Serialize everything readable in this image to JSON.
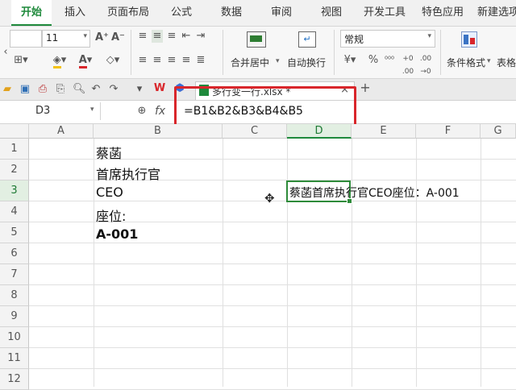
{
  "ribbon_tabs": [
    "开始",
    "插入",
    "页面布局",
    "公式",
    "数据",
    "审阅",
    "视图",
    "开发工具",
    "特色应用",
    "新建选项"
  ],
  "font_size": "11",
  "merge_label": "合并居中",
  "wrap_label": "自动换行",
  "number_format": "常规",
  "cond_format_label": "条件格式",
  "table_label": "表格",
  "document_tab": "多行变一行.xlsx *",
  "name_box": "D3",
  "fx_label": "fx",
  "formula": "=B1&B2&B3&B4&B5",
  "columns": [
    "A",
    "B",
    "C",
    "D",
    "E",
    "F",
    "G"
  ],
  "rows": [
    "1",
    "2",
    "3",
    "4",
    "5",
    "6",
    "7",
    "8",
    "9",
    "10",
    "11",
    "12"
  ],
  "cells": {
    "B1": "蔡菡",
    "B2": "首席执行官",
    "B3": "CEO",
    "B4": "座位:",
    "B5": "A-001",
    "D3": "蔡菡首席执行官CEO座位：A-001"
  },
  "accent_color": "#1f8a3c",
  "highlight_color": "#d9262b"
}
